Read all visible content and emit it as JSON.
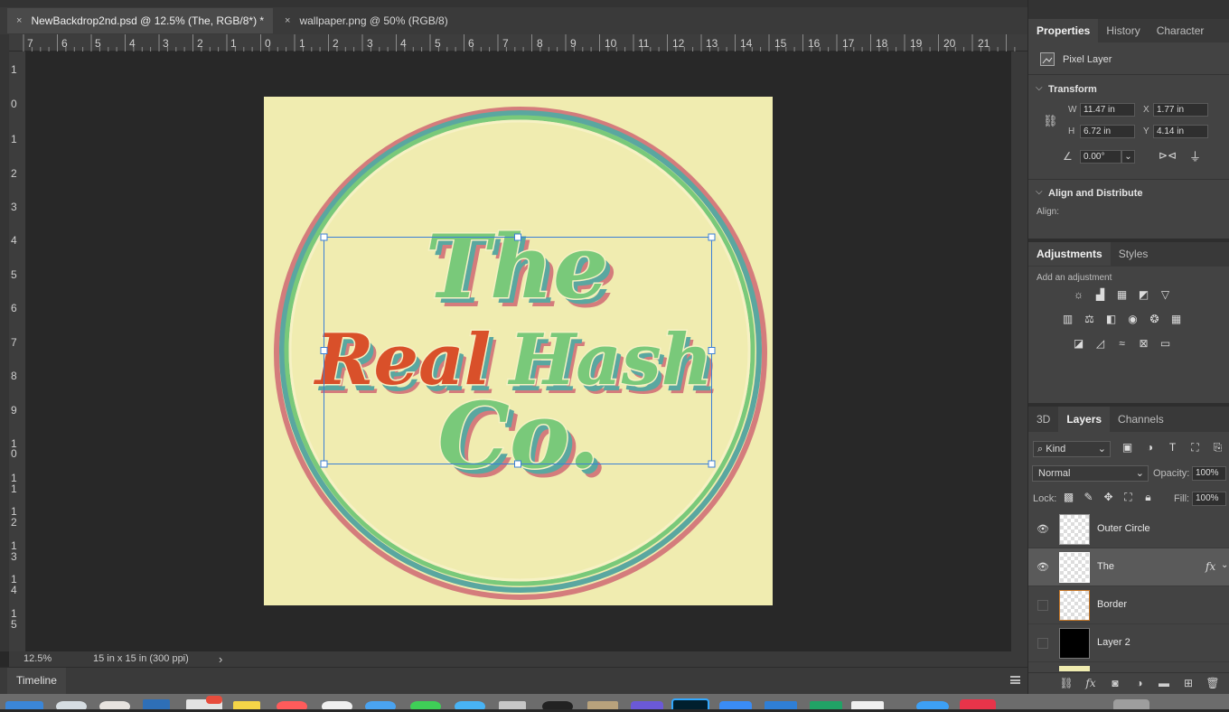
{
  "tabs": [
    {
      "close": "×",
      "label": "NewBackdrop2nd.psd @ 12.5% (The, RGB/8*) *"
    },
    {
      "close": "×",
      "label": "wallpaper.png @ 50% (RGB/8)"
    }
  ],
  "ruler": {
    "h_labels": [
      "7",
      "6",
      "5",
      "4",
      "3",
      "2",
      "1",
      "0",
      "1",
      "2",
      "3",
      "4",
      "5",
      "6",
      "7",
      "8",
      "9",
      "10",
      "11",
      "12",
      "13",
      "14",
      "15",
      "16",
      "17",
      "18",
      "19",
      "20",
      "21"
    ],
    "v_labels": [
      "1",
      "0",
      "1",
      "2",
      "3",
      "4",
      "5",
      "6",
      "7",
      "8",
      "9",
      "1",
      "0",
      "1",
      "1",
      "1",
      "2",
      "1",
      "3",
      "1",
      "4",
      "1",
      "5"
    ]
  },
  "artwork": {
    "line1": "The",
    "line2a": "Real",
    "line2b": "Hash",
    "line3": "Co.",
    "colors": {
      "background": "#f0ecb0",
      "green": "#79c97a",
      "teal": "#5aa7a0",
      "pink": "#d47c7c",
      "orange": "#d9502a",
      "outline": "#f6f1c4"
    }
  },
  "status": {
    "zoom": "12.5%",
    "doc_info": "15 in x 15 in (300 ppi)",
    "arrow": "›"
  },
  "timeline": {
    "label": "Timeline",
    "menu_icon": "hamburger-icon"
  },
  "properties": {
    "tabs": [
      "Properties",
      "History",
      "Character"
    ],
    "layer_kind": "Pixel Layer",
    "transform_title": "Transform",
    "w_label": "W",
    "w_value": "11.47 in",
    "x_label": "X",
    "x_value": "1.77 in",
    "h_label": "H",
    "h_value": "6.72 in",
    "y_label": "Y",
    "y_value": "4.14 in",
    "angle_value": "0.00°",
    "align_title": "Align and Distribute",
    "align_label": "Align:"
  },
  "adjustments": {
    "tabs": [
      "Adjustments",
      "Styles"
    ],
    "add_label": "Add an adjustment"
  },
  "layers": {
    "tabs": [
      "3D",
      "Layers",
      "Channels"
    ],
    "filter_kind": "Kind",
    "blend_mode": "Normal",
    "opacity_label": "Opacity:",
    "opacity_value": "100%",
    "lock_label": "Lock:",
    "fill_label": "Fill:",
    "fill_value": "100%",
    "items": [
      {
        "name": "Outer Circle",
        "visible": true
      },
      {
        "name": "The",
        "visible": true,
        "fx": "fx"
      },
      {
        "name": "Border",
        "visible": false
      },
      {
        "name": "Layer 2",
        "visible": false
      }
    ]
  }
}
